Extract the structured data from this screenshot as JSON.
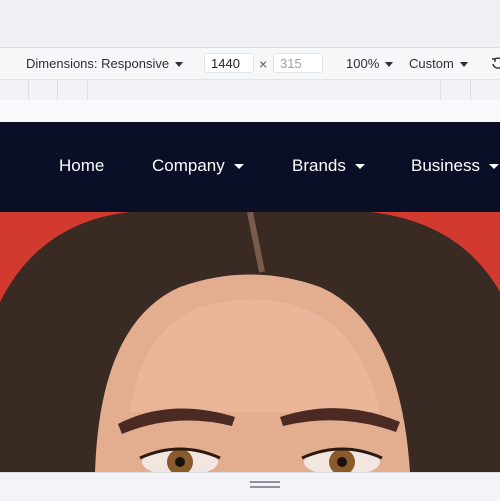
{
  "toolbar": {
    "dimensions_label": "Dimensions: Responsive",
    "width_value": "1440",
    "times": "×",
    "height_placeholder": "315",
    "zoom_label": "100%",
    "throttle_label": "Custom"
  },
  "navbar": {
    "items": [
      {
        "label": "Home"
      },
      {
        "label": "Company"
      },
      {
        "label": "Brands"
      },
      {
        "label": "Business"
      }
    ]
  },
  "colors": {
    "navbar_bg": "#0a0e27",
    "hero_bg": "#d23a30"
  },
  "icons": [
    "caret-down-icon",
    "rotate-icon",
    "drag-handle-icon"
  ]
}
